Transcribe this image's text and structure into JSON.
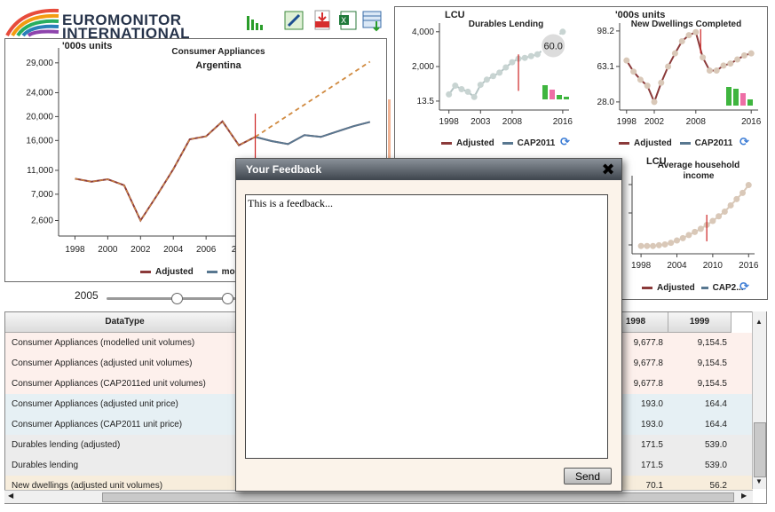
{
  "header": {
    "logo_line1": "EUROMONITOR",
    "logo_line2": "INTERNATIONAL",
    "tools": [
      "chart-icon",
      "edit-icon",
      "pdf-export-icon",
      "excel-export-icon",
      "table-export-icon"
    ]
  },
  "main_chart": {
    "unit": "'000s units",
    "title": "Consumer Appliances",
    "subtitle": "Argentina",
    "legend": [
      "Adjusted",
      "mode"
    ],
    "colors": {
      "adjusted": "#8b3a3a",
      "modelled": "#587790",
      "forecast": "#d08a40"
    }
  },
  "slider": {
    "year": "2005",
    "start": 0.5,
    "end": 0.85
  },
  "mini_charts": {
    "durables": {
      "unit": "LCU",
      "title": "Durables Lending",
      "legend_a": "Adjusted",
      "legend_b": "CAP2011",
      "tooltip": "60.0"
    },
    "dwellings": {
      "unit": "'000s units",
      "title": "New Dwellings Completed",
      "legend_a": "Adjusted",
      "legend_b": "CAP2011"
    },
    "household": {
      "unit": "LCU",
      "title_line1": "Average household",
      "title_line2": "income",
      "legend_a": "Adjusted",
      "legend_b": "CAP2..."
    }
  },
  "chart_data": [
    {
      "type": "line",
      "title": "Consumer Appliances",
      "subtitle": "Argentina",
      "ylabel": "'000s units",
      "y_ticks": [
        "29,000",
        "24,000",
        "20,000",
        "16,000",
        "11,000",
        "7,000",
        "2,600"
      ],
      "x_ticks": [
        "1998",
        "2000",
        "2002",
        "2004",
        "2006",
        "200"
      ],
      "ylim": [
        0,
        31500
      ],
      "xlim": [
        1997,
        2016.5
      ],
      "series": [
        {
          "name": "Adjusted",
          "x": [
            1998,
            1999,
            2000,
            2001,
            2002,
            2003,
            2004,
            2005,
            2006,
            2007,
            2008,
            2009,
            2010,
            2011,
            2012,
            2013,
            2014,
            2015,
            2016
          ],
          "values": [
            9600,
            9100,
            9500,
            8500,
            2600,
            6800,
            11200,
            16200,
            16700,
            19200,
            15200,
            16600,
            15900,
            15400,
            16900,
            16600,
            17500,
            18400,
            19100
          ]
        },
        {
          "name": "forecast",
          "x": [
            2009,
            2016
          ],
          "values": [
            16600,
            29200
          ]
        }
      ]
    },
    {
      "type": "line",
      "title": "Durables Lending",
      "ylabel": "LCU",
      "y_ticks": [
        "4,000",
        "2,000",
        "13.5"
      ],
      "x_ticks": [
        "1998",
        "2003",
        "2008",
        "2016"
      ],
      "ylim": [
        -500,
        4500
      ],
      "xlim": [
        1996.5,
        2017
      ],
      "series": [
        {
          "name": "Adjusted",
          "x": [
            1998,
            1999,
            2000,
            2001,
            2002,
            2003,
            2004,
            2005,
            2006,
            2007,
            2008,
            2009,
            2010,
            2011,
            2012,
            2013,
            2014,
            2015,
            2016
          ],
          "values": [
            400,
            900,
            700,
            550,
            250,
            950,
            1250,
            1450,
            1650,
            1950,
            2250,
            2450,
            2500,
            2600,
            2700,
            3000,
            3250,
            3700,
            4000
          ]
        }
      ]
    },
    {
      "type": "line",
      "title": "New Dwellings Completed",
      "ylabel": "'000s units",
      "y_ticks": [
        "98.2",
        "63.1",
        "28.0"
      ],
      "x_ticks": [
        "1998",
        "2002",
        "2008",
        "2016"
      ],
      "ylim": [
        20,
        106
      ],
      "xlim": [
        1997,
        2017
      ],
      "series": [
        {
          "name": "Adjusted",
          "x": [
            1998,
            1999,
            2000,
            2001,
            2002,
            2003,
            2004,
            2005,
            2006,
            2007,
            2008,
            2009,
            2010,
            2011,
            2012,
            2013,
            2014,
            2015,
            2016
          ],
          "values": [
            69,
            58,
            50,
            44,
            28,
            47,
            63,
            76,
            88,
            94,
            97,
            72,
            59,
            59,
            64,
            66,
            70,
            74,
            76
          ]
        }
      ]
    },
    {
      "type": "line",
      "title": "Average household income",
      "ylabel": "LCU",
      "x_ticks": [
        "1998",
        "2004",
        "2010",
        "2016"
      ],
      "ylim": [
        0,
        100
      ],
      "xlim": [
        1996.5,
        2017
      ],
      "series": [
        {
          "name": "Adjusted",
          "x": [
            1998,
            1999,
            2000,
            2001,
            2002,
            2003,
            2004,
            2005,
            2006,
            2007,
            2008,
            2009,
            2010,
            2011,
            2012,
            2013,
            2014,
            2015,
            2016
          ],
          "values": [
            10,
            10,
            10,
            11,
            12,
            14,
            17,
            20,
            24,
            28,
            32,
            37,
            42,
            48,
            54,
            62,
            70,
            78,
            88
          ]
        }
      ]
    }
  ],
  "table": {
    "headers": [
      "DataType",
      "1998",
      "1999"
    ],
    "rows": [
      {
        "name": "Consumer Appliances (modelled unit volumes)",
        "v1998": "9,677.8",
        "v1999": "9,154.5",
        "bg": "#fdf0ec"
      },
      {
        "name": "Consumer Appliances (adjusted unit volumes)",
        "v1998": "9,677.8",
        "v1999": "9,154.5",
        "bg": "#fdf0ec"
      },
      {
        "name": "Consumer Appliances (CAP2011ed unit volumes)",
        "v1998": "9,677.8",
        "v1999": "9,154.5",
        "bg": "#fdf0ec"
      },
      {
        "name": "Consumer Appliances (adjusted unit price)",
        "v1998": "193.0",
        "v1999": "164.4",
        "bg": "#e6f0f4"
      },
      {
        "name": "Consumer Appliances (CAP2011 unit price)",
        "v1998": "193.0",
        "v1999": "164.4",
        "bg": "#e6f0f4"
      },
      {
        "name": "Durables lending (adjusted)",
        "v1998": "171.5",
        "v1999": "539.0",
        "bg": "#ececec"
      },
      {
        "name": "Durables lending",
        "v1998": "171.5",
        "v1999": "539.0",
        "bg": "#ececec"
      },
      {
        "name": "New dwellings (adjusted unit volumes)",
        "v1998": "70.1",
        "v1999": "56.2",
        "bg": "#f7eddc"
      }
    ]
  },
  "dialog": {
    "title": "Your Feedback",
    "text": "This is a feedback...",
    "send_label": "Send"
  }
}
